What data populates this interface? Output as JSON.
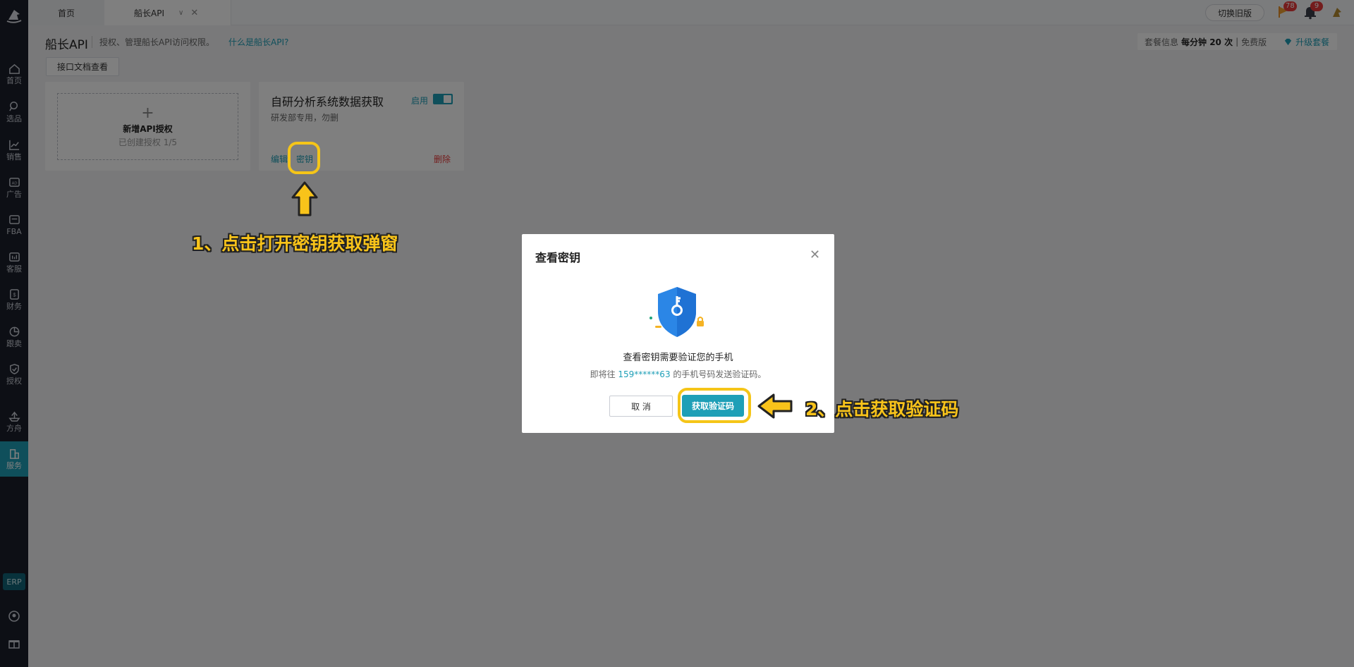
{
  "sidebar": {
    "items": [
      {
        "label": "首页",
        "icon": "home-icon"
      },
      {
        "label": "选品",
        "icon": "search-icon"
      },
      {
        "label": "销售",
        "icon": "line-chart-icon"
      },
      {
        "label": "广告",
        "icon": "ad-icon"
      },
      {
        "label": "FBA",
        "icon": "fba-icon"
      },
      {
        "label": "客服",
        "icon": "service-icon"
      },
      {
        "label": "财务",
        "icon": "finance-icon"
      },
      {
        "label": "跟卖",
        "icon": "pie-chart-icon"
      },
      {
        "label": "授权",
        "icon": "shield-check-icon"
      },
      {
        "label": "方舟",
        "icon": "ark-icon"
      },
      {
        "label": "服务",
        "icon": "building-icon"
      }
    ],
    "erp_label": "ERP"
  },
  "topbar": {
    "tabs": [
      {
        "label": "首页"
      },
      {
        "label": "船长API"
      }
    ],
    "switch_old_label": "切换旧版",
    "flag_badge": "78",
    "bell_badge": "9"
  },
  "page": {
    "title": "船长API",
    "description": "授权、管理船长API访问权限。",
    "what_link": "什么是船长API?",
    "package": {
      "label": "套餐信息",
      "rate": "每分钟 20 次",
      "separator": "|",
      "plan": "免费版",
      "upgrade_label": "升级套餐"
    },
    "doc_button": "接口文档查看"
  },
  "new_card": {
    "plus": "+",
    "title": "新增API授权",
    "subtitle": "已创建授权 1/5"
  },
  "api_card": {
    "name": "自研分析系统数据获取",
    "description": "研发部专用，勿删",
    "enable_label": "启用",
    "enabled": true,
    "edit_label": "编辑",
    "key_label": "密钥",
    "delete_label": "删除"
  },
  "modal": {
    "title": "查看密钥",
    "main_text": "查看密钥需要验证您的手机",
    "sub_prefix": "即将往",
    "phone": "159******63",
    "sub_suffix": "的手机号码发送验证码。",
    "cancel_label": "取 消",
    "get_code_label": "获取验证码"
  },
  "annotations": {
    "step1": "1、点击打开密钥获取弹窗",
    "step2": "2、点击获取验证码"
  },
  "colors": {
    "accent": "#1e9fb7",
    "sidebar_bg": "#1b1f2a",
    "danger": "#e83b3b",
    "annotation": "#f8c31a"
  }
}
